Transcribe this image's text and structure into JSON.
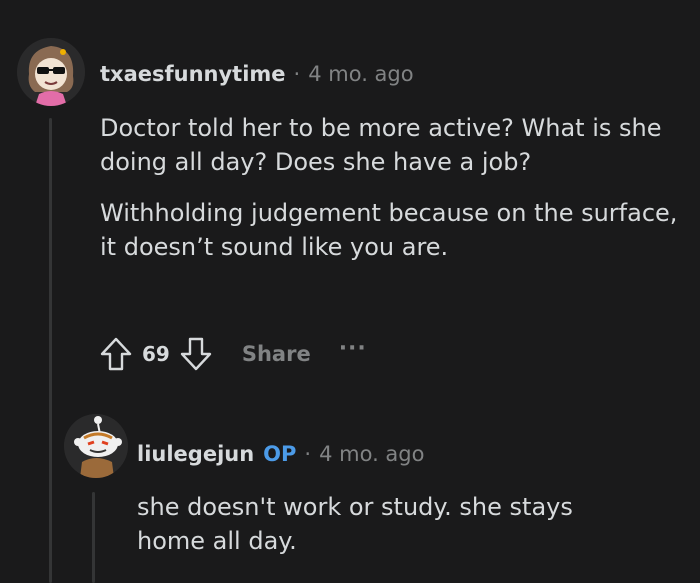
{
  "comment1": {
    "username": "txaesfunnytime",
    "separator": "·",
    "age": "4 mo. ago",
    "paragraphs": [
      "Doctor told her to be more active? What is she doing all day? Does she have a job?",
      "Withholding judgement because on the surface, it doesn’t sound like you are."
    ],
    "score": "69",
    "share_label": "Share",
    "more_label": "···"
  },
  "comment2": {
    "username": "liulegejun",
    "op_badge": "OP",
    "separator": "·",
    "age": "4 mo. ago",
    "paragraphs": [
      "she doesn't work or study. she stays home all day."
    ]
  },
  "colors": {
    "background": "#1a1a1b",
    "text": "#d7dadc",
    "muted": "#818384",
    "op": "#4c9be8",
    "thread_line": "#343536"
  },
  "icons": {
    "upvote": "arrow-up-outline-icon",
    "downvote": "arrow-down-outline-icon"
  }
}
